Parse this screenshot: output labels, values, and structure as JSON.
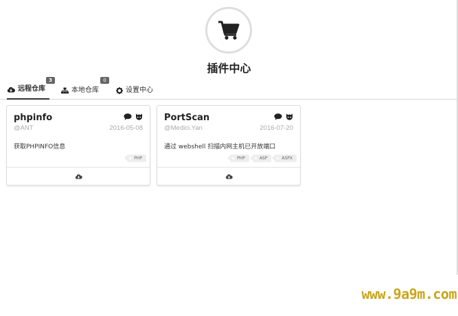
{
  "header": {
    "title": "插件中心",
    "icon": "shopping-cart-icon"
  },
  "tabs": [
    {
      "label": "远程仓库",
      "badge": "3",
      "icon": "cloud-icon",
      "active": true
    },
    {
      "label": "本地仓库",
      "badge": "0",
      "icon": "sitemap-icon",
      "active": false
    },
    {
      "label": "设置中心",
      "badge": "",
      "icon": "gear-icon",
      "active": false
    }
  ],
  "plugins": [
    {
      "name": "phpinfo",
      "author": "@ANT",
      "date": "2016-05-08",
      "description": "获取PHPINFO信息",
      "tags": [
        "PHP"
      ]
    },
    {
      "name": "PortScan",
      "author": "@Medici.Yan",
      "date": "2016-07-20",
      "description": "通过 webshell 扫描内网主机已开放端口",
      "tags": [
        "PHP",
        "ASP",
        "ASPX"
      ]
    }
  ],
  "watermark": "www.9a9m.com",
  "colors": {
    "accent": "#333333",
    "badge": "#666666",
    "watermark": "#c9a51a"
  }
}
